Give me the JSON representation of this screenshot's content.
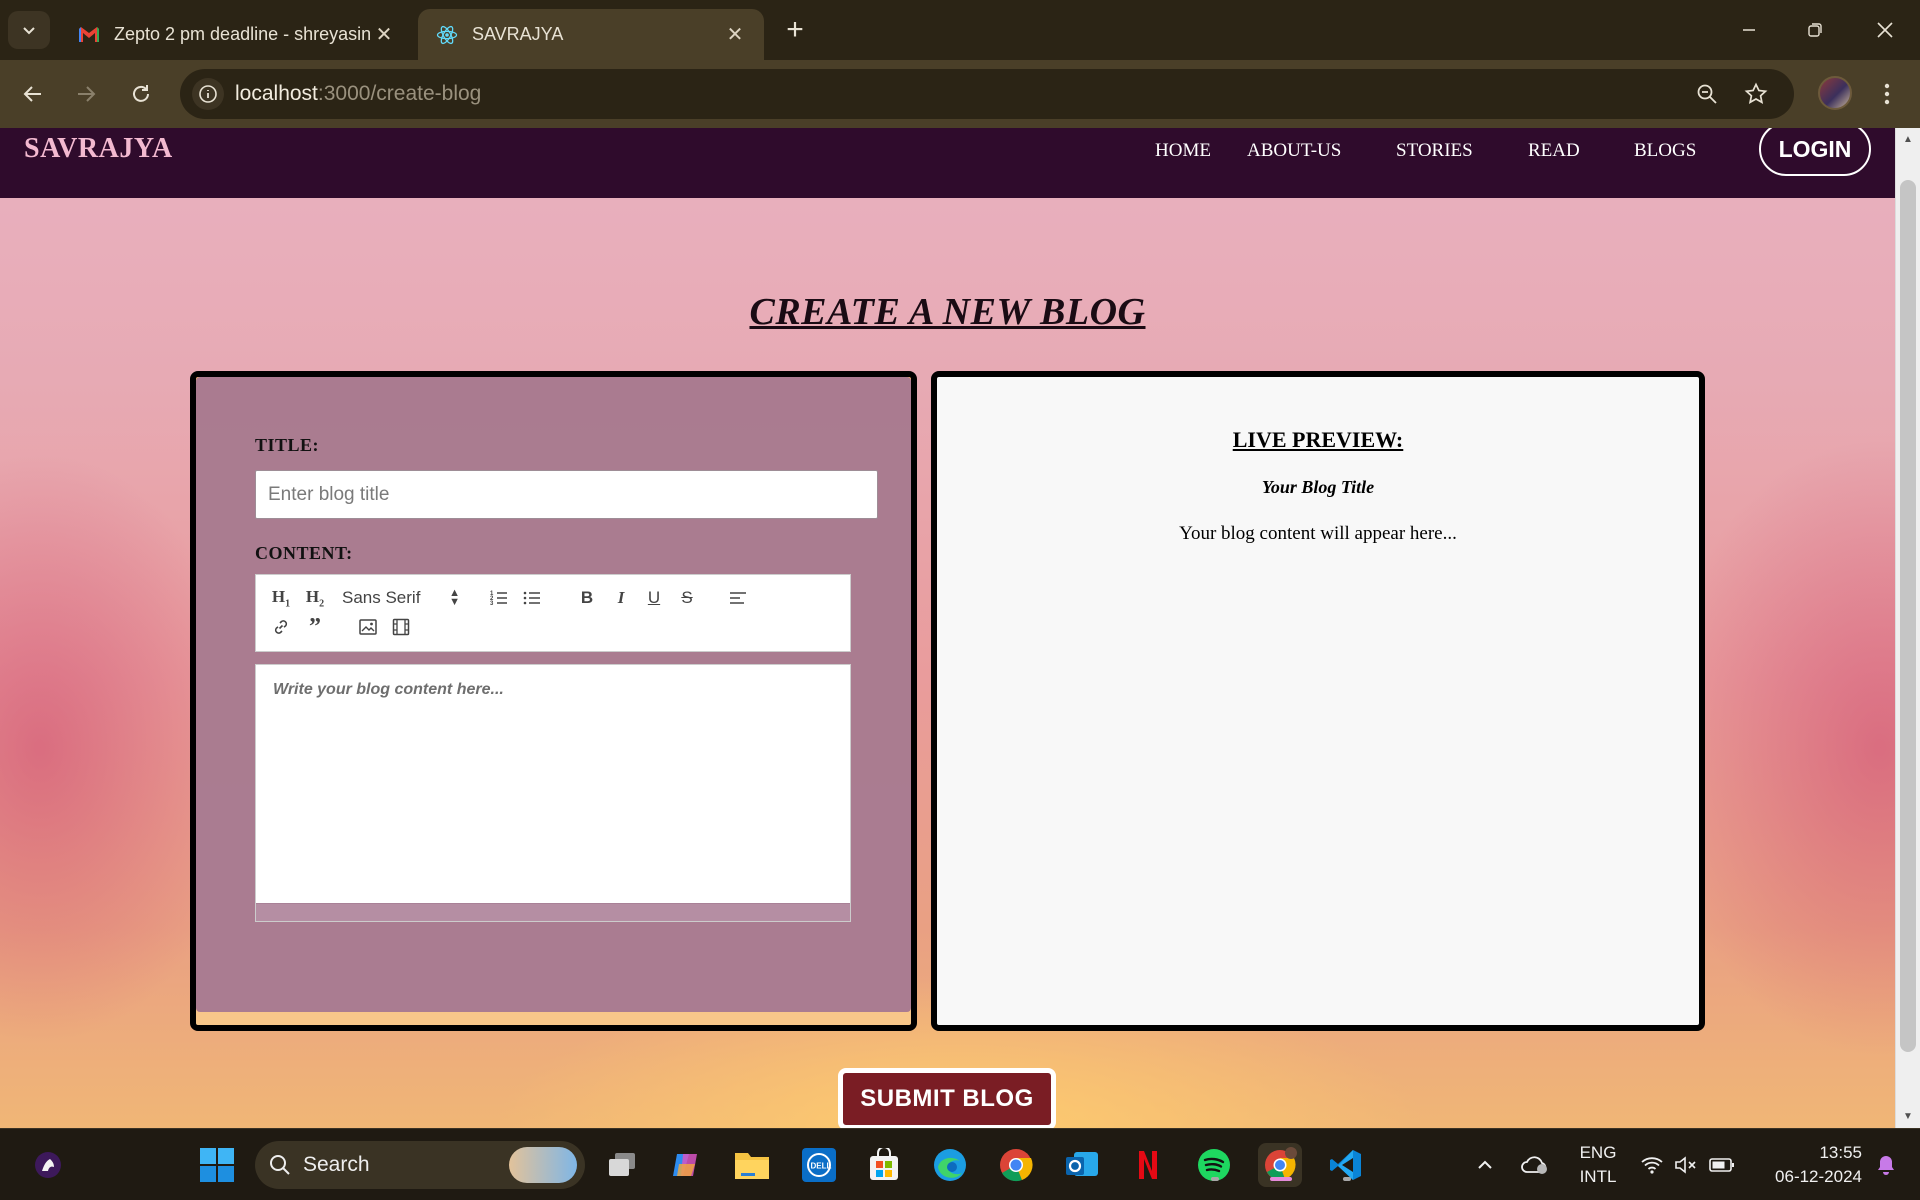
{
  "browser": {
    "tabs": [
      {
        "title": "Zepto 2 pm deadline - shreyasin",
        "favicon": "gmail-icon",
        "active": false
      },
      {
        "title": "SAVRAJYA",
        "favicon": "react-icon",
        "active": true
      }
    ],
    "url_host": "localhost",
    "url_path": ":3000/create-blog"
  },
  "site": {
    "brand": "SAVRAJYA",
    "nav": {
      "home": "HOME",
      "about": "ABOUT-US",
      "stories": "STORIES",
      "read": "READ",
      "blogs": "BLOGS",
      "login": "LOGIN"
    }
  },
  "page": {
    "heading": "CREATE A NEW BLOG",
    "form": {
      "title_label": "TITLE:",
      "title_placeholder": "Enter blog title",
      "title_value": "",
      "content_label": "CONTENT:",
      "font_select": "Sans Serif",
      "editor_placeholder": "Write your blog content here...",
      "toolbar": {
        "h1": "H1",
        "h2": "H2"
      }
    },
    "preview": {
      "heading": "LIVE PREVIEW:",
      "title": "Your Blog Title",
      "content": "Your blog content will appear here..."
    },
    "submit_label": "SUBMIT BLOG"
  },
  "taskbar": {
    "search_label": "Search",
    "language": "ENG",
    "layout": "INTL",
    "time": "13:55",
    "date": "06-12-2024"
  },
  "colors": {
    "nav_bg": "#2f0b2c",
    "brand": "#f3b9d0",
    "submit_bg": "#7a1d24",
    "editor_panel": "#a5788f",
    "preview_bg": "#f8f8f8"
  }
}
